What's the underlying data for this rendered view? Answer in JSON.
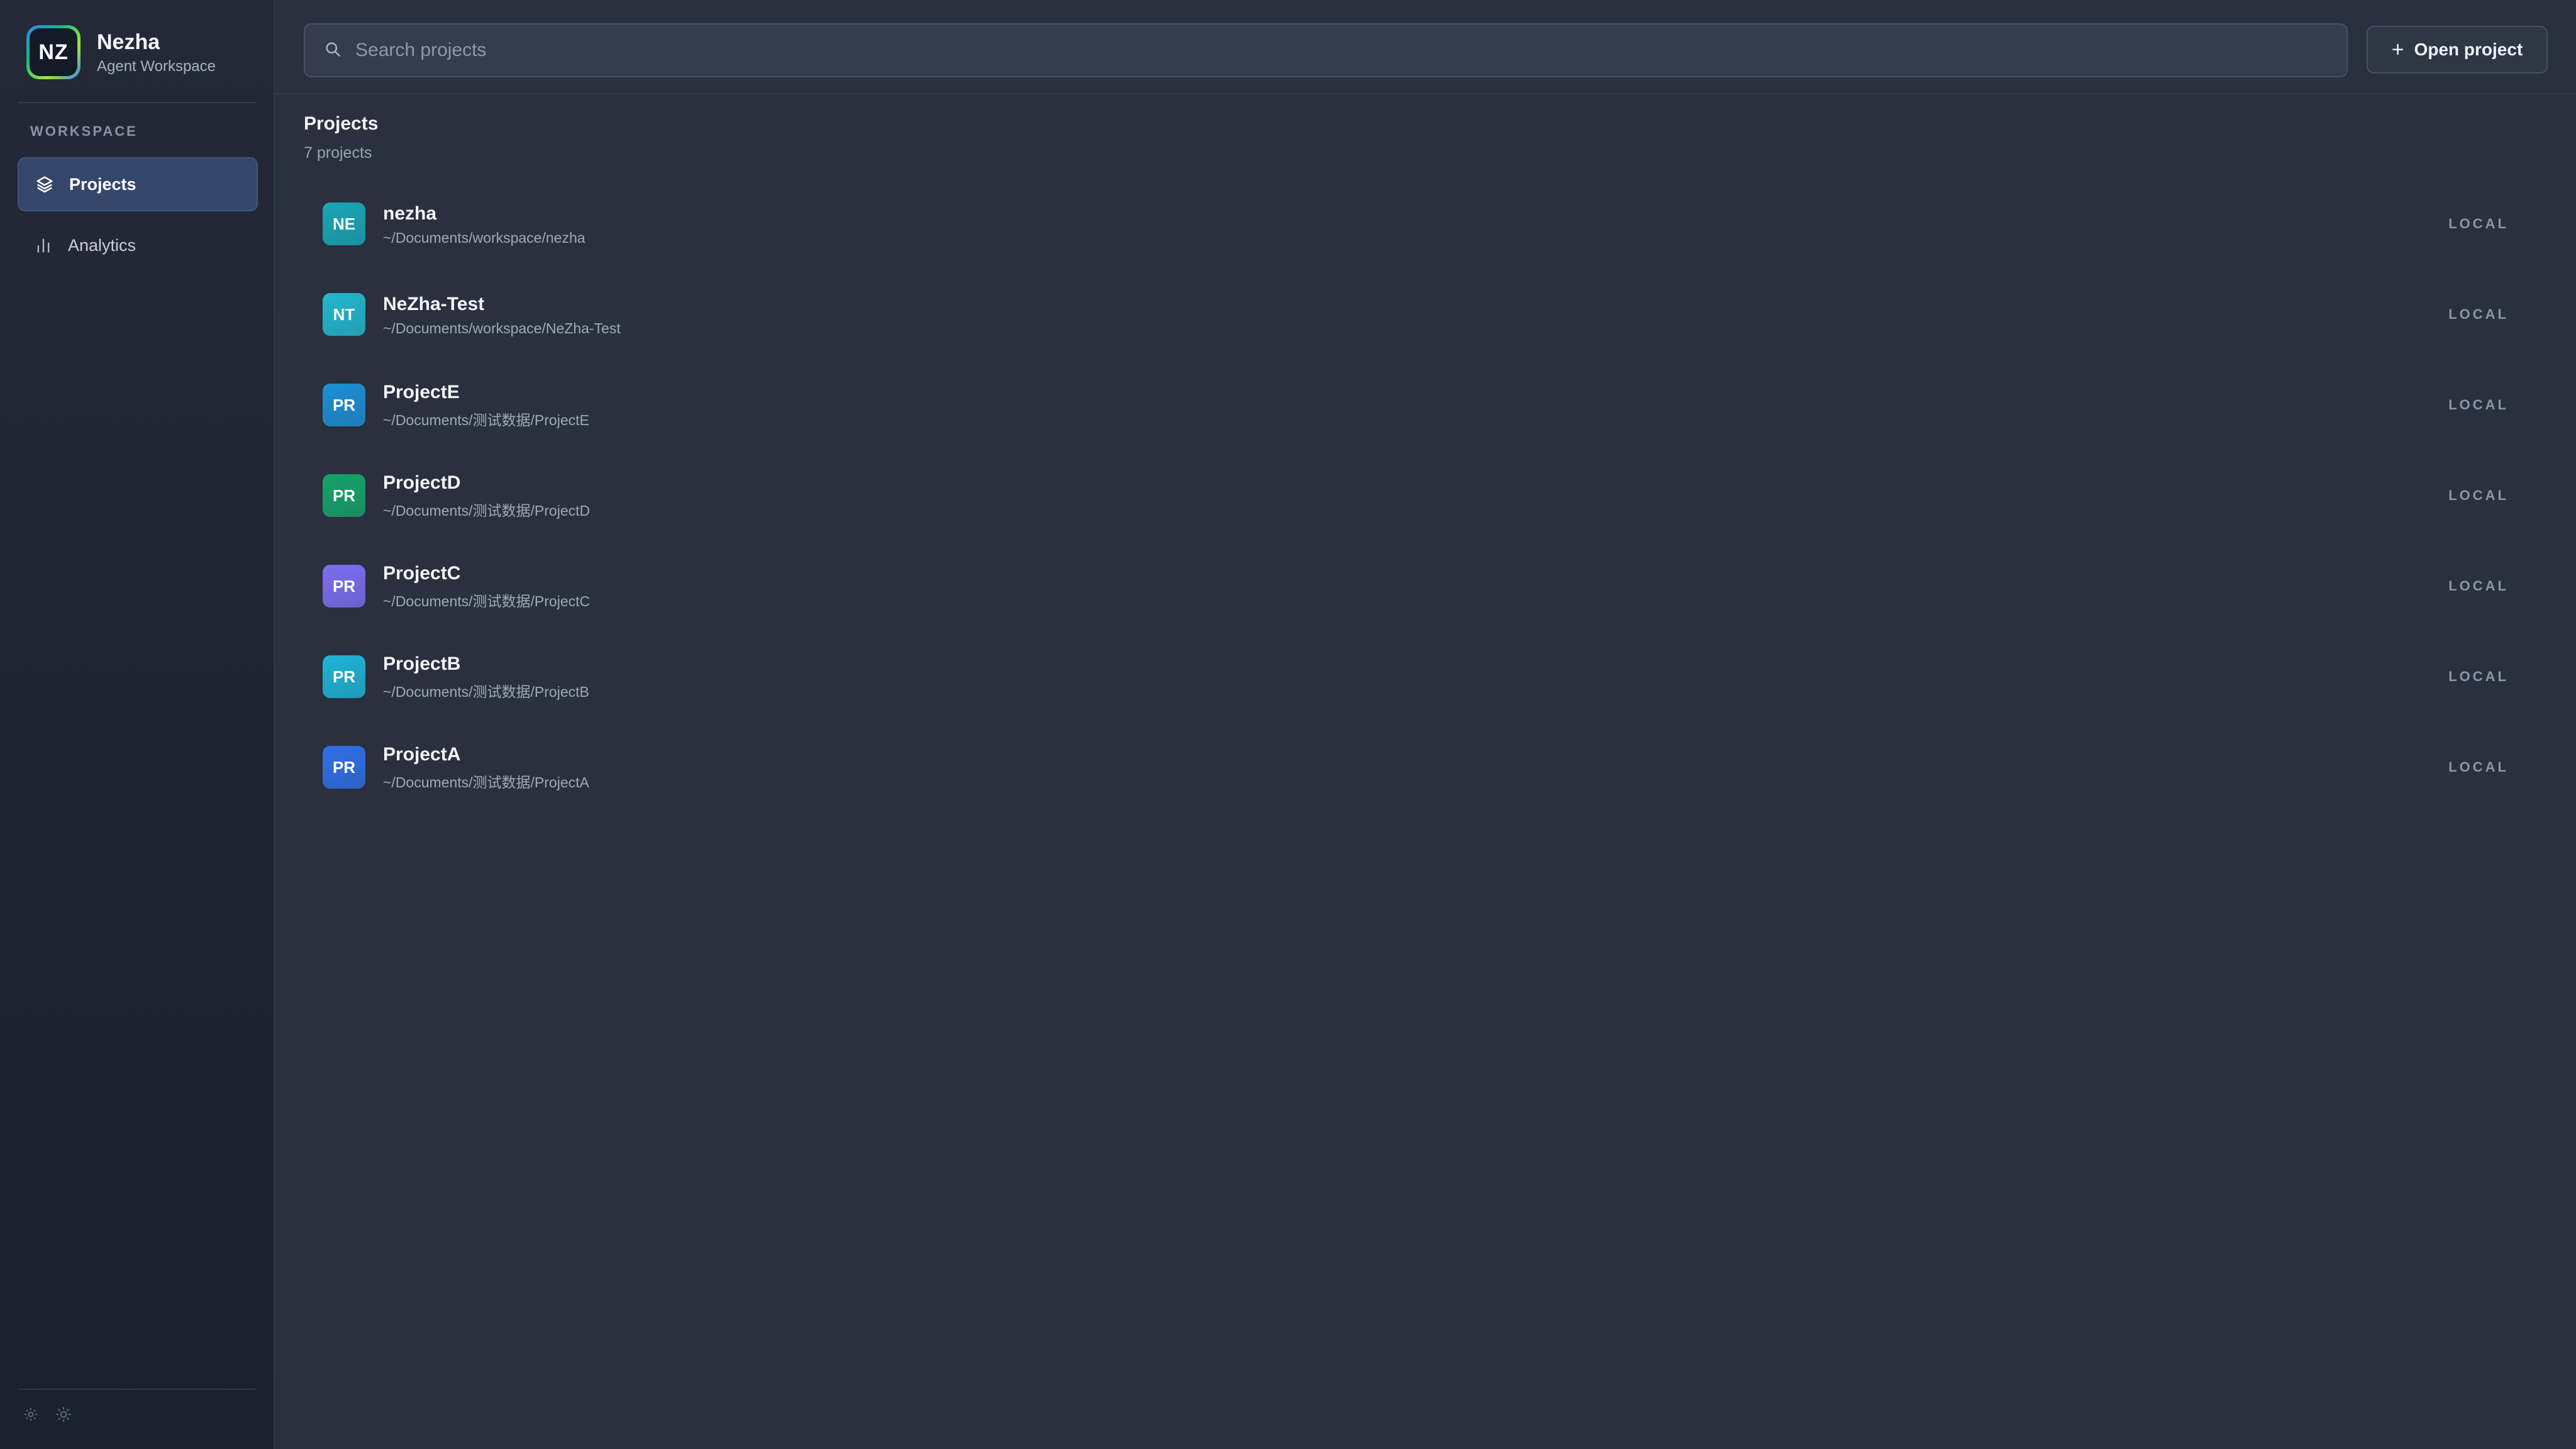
{
  "brand": {
    "logo_text": "NZ",
    "name": "Nezha",
    "subtitle": "Agent Workspace"
  },
  "sidebar": {
    "section_label": "WORKSPACE",
    "items": [
      {
        "label": "Projects",
        "icon": "layers-icon",
        "active": true
      },
      {
        "label": "Analytics",
        "icon": "bar-chart-icon",
        "active": false
      }
    ],
    "footer_icons": [
      "settings-icon",
      "sun-icon"
    ]
  },
  "topbar": {
    "search_placeholder": "Search projects",
    "open_button_label": "Open project"
  },
  "main": {
    "title": "Projects",
    "count_text": "7 projects",
    "projects": [
      {
        "initials": "NE",
        "name": "nezha",
        "path": "~/Documents/workspace/nezha",
        "tag": "LOCAL",
        "color": "#1aa6b7"
      },
      {
        "initials": "NT",
        "name": "NeZha-Test",
        "path": "~/Documents/workspace/NeZha-Test",
        "tag": "LOCAL",
        "color": "#22b8cf"
      },
      {
        "initials": "PR",
        "name": "ProjectE",
        "path": "~/Documents/测试数据/ProjectE",
        "tag": "LOCAL",
        "color": "#1c8fd6"
      },
      {
        "initials": "PR",
        "name": "ProjectD",
        "path": "~/Documents/测试数据/ProjectD",
        "tag": "LOCAL",
        "color": "#16a36a"
      },
      {
        "initials": "PR",
        "name": "ProjectC",
        "path": "~/Documents/测试数据/ProjectC",
        "tag": "LOCAL",
        "color": "#7b6ef0"
      },
      {
        "initials": "PR",
        "name": "ProjectB",
        "path": "~/Documents/测试数据/ProjectB",
        "tag": "LOCAL",
        "color": "#1fb4d6"
      },
      {
        "initials": "PR",
        "name": "ProjectA",
        "path": "~/Documents/测试数据/ProjectA",
        "tag": "LOCAL",
        "color": "#2f6fe8"
      }
    ]
  }
}
